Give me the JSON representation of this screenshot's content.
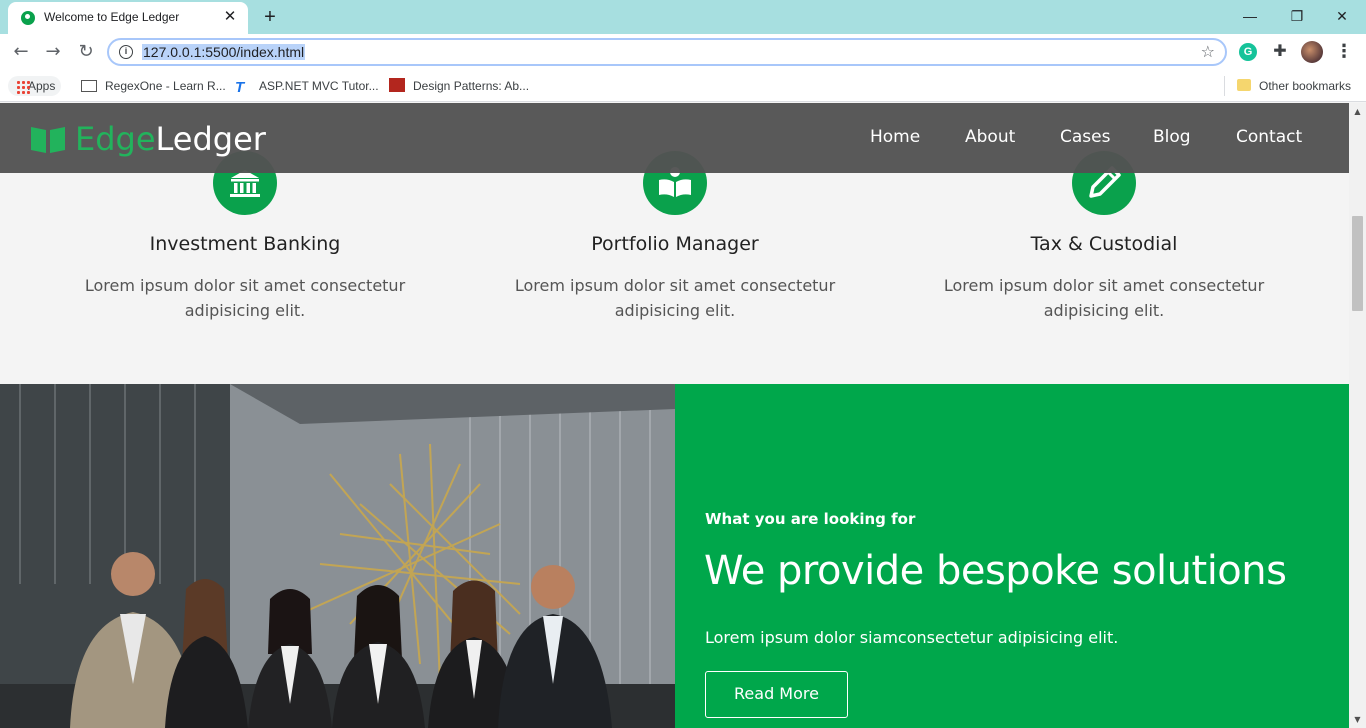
{
  "browser": {
    "tab_title": "Welcome to Edge Ledger",
    "tab_close": "✕",
    "new_tab": "+",
    "url": "127.0.0.1:5500/index.html",
    "window_controls": {
      "minimize": "—",
      "restore": "❐",
      "close": "✕"
    },
    "extension_letter": "G",
    "bookmarks": [
      {
        "label": "Apps"
      },
      {
        "label": "RegexOne - Learn R..."
      },
      {
        "label": "ASP.NET MVC Tutor..."
      },
      {
        "label": "Design Patterns: Ab..."
      }
    ],
    "other_bookmarks": "Other bookmarks"
  },
  "site": {
    "logo": {
      "part1": "Edge",
      "part2": "Ledger"
    },
    "nav": [
      "Home",
      "About",
      "Cases",
      "Blog",
      "Contact"
    ]
  },
  "features": [
    {
      "icon": "bank-icon",
      "title": "Investment Banking",
      "text": "Lorem ipsum dolor sit amet consectetur adipisicing elit."
    },
    {
      "icon": "book-reader-icon",
      "title": "Portfolio Manager",
      "text": "Lorem ipsum dolor sit amet consectetur adipisicing elit."
    },
    {
      "icon": "pencil-icon",
      "title": "Tax & Custodial",
      "text": "Lorem ipsum dolor sit amet consectetur adipisicing elit."
    }
  ],
  "solutions": {
    "kicker": "What you are looking for",
    "headline": "We provide bespoke solutions",
    "lead": "Lorem ipsum dolor siamconsectetur adipisicing elit.",
    "button": "Read More"
  },
  "colors": {
    "brand_green": "#00a74b",
    "nav_bg": "#525252",
    "tabstrip": "#a7dfe0"
  }
}
